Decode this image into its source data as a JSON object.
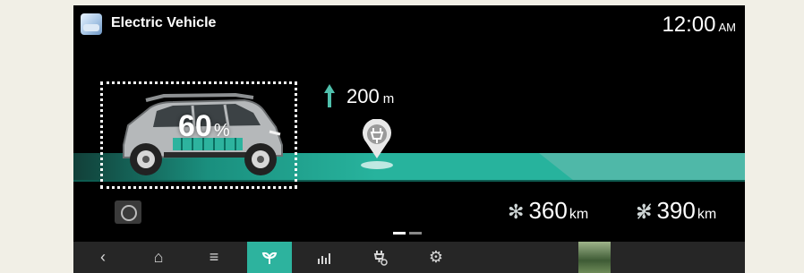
{
  "header": {
    "title": "Electric Vehicle",
    "clock_time": "12:00",
    "clock_ampm": "AM"
  },
  "battery": {
    "percent": "60",
    "unit": "%"
  },
  "navigation": {
    "distance": "200",
    "unit": "m"
  },
  "ranges": [
    {
      "value": "360",
      "unit": "km",
      "icon": "fan-icon"
    },
    {
      "value": "390",
      "unit": "km",
      "icon": "fan-off-icon"
    }
  ],
  "pager": {
    "pages": 2,
    "current": 1
  },
  "bottom_nav": {
    "back": "‹",
    "home": "⌂",
    "menu": "≡",
    "eco": "🌱",
    "stats": "ılıl",
    "charge": "⚡",
    "settings": "⚙"
  },
  "colors": {
    "accent": "#2db39e",
    "road": "#27b39d",
    "background": "#000000"
  }
}
